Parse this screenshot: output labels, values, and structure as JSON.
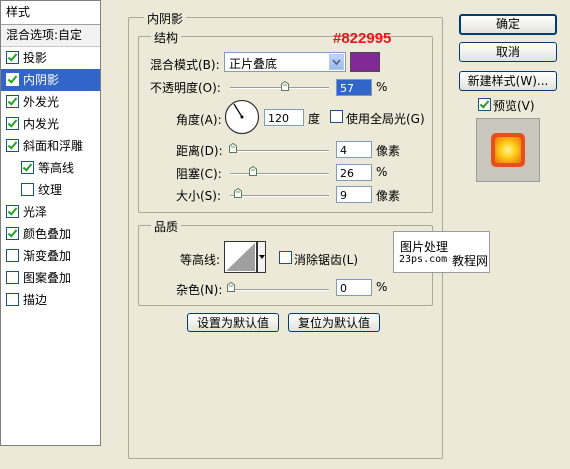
{
  "left_panel": {
    "header": "样式",
    "blend_options": "混合选项:自定",
    "items": [
      {
        "label": "投影",
        "checked": true,
        "selected": false,
        "indent": false,
        "has_cb": true
      },
      {
        "label": "内阴影",
        "checked": true,
        "selected": true,
        "indent": false,
        "has_cb": true
      },
      {
        "label": "外发光",
        "checked": true,
        "selected": false,
        "indent": false,
        "has_cb": true
      },
      {
        "label": "内发光",
        "checked": true,
        "selected": false,
        "indent": false,
        "has_cb": true
      },
      {
        "label": "斜面和浮雕",
        "checked": true,
        "selected": false,
        "indent": false,
        "has_cb": true
      },
      {
        "label": "等高线",
        "checked": true,
        "selected": false,
        "indent": true,
        "has_cb": true
      },
      {
        "label": "纹理",
        "checked": false,
        "selected": false,
        "indent": true,
        "has_cb": true
      },
      {
        "label": "光泽",
        "checked": true,
        "selected": false,
        "indent": false,
        "has_cb": true
      },
      {
        "label": "颜色叠加",
        "checked": true,
        "selected": false,
        "indent": false,
        "has_cb": true
      },
      {
        "label": "渐变叠加",
        "checked": false,
        "selected": false,
        "indent": false,
        "has_cb": true
      },
      {
        "label": "图案叠加",
        "checked": false,
        "selected": false,
        "indent": false,
        "has_cb": true
      },
      {
        "label": "描边",
        "checked": false,
        "selected": false,
        "indent": false,
        "has_cb": true
      }
    ]
  },
  "panel": {
    "title": "内阴影",
    "structure": {
      "title": "结构",
      "blend_mode_label": "混合模式(B):",
      "blend_mode_value": "正片叠底",
      "color_swatch": "#822995",
      "color_hex_text": "#822995",
      "opacity_label": "不透明度(O):",
      "opacity_value": "57",
      "opacity_unit": "%",
      "angle_label": "角度(A):",
      "angle_value": "120",
      "angle_unit": "度",
      "global_light_label": "使用全局光(G)",
      "distance_label": "距离(D):",
      "distance_value": "4",
      "distance_unit": "像素",
      "choke_label": "阻塞(C):",
      "choke_value": "26",
      "choke_unit": "%",
      "size_label": "大小(S):",
      "size_value": "9",
      "size_unit": "像素"
    },
    "quality": {
      "title": "品质",
      "contour_label": "等高线:",
      "antialias_label": "消除锯齿(L)",
      "noise_label": "杂色(N):",
      "noise_value": "0",
      "noise_unit": "%"
    },
    "make_default": "设置为默认值",
    "reset_default": "复位为默认值"
  },
  "watermark": {
    "line1": "图片处理",
    "line2_site": "23ps.com",
    "line2_text": "教程网"
  },
  "right": {
    "ok": "确定",
    "cancel": "取消",
    "new_style": "新建样式(W)...",
    "preview_label": "预览(V)",
    "preview_checked": true
  }
}
